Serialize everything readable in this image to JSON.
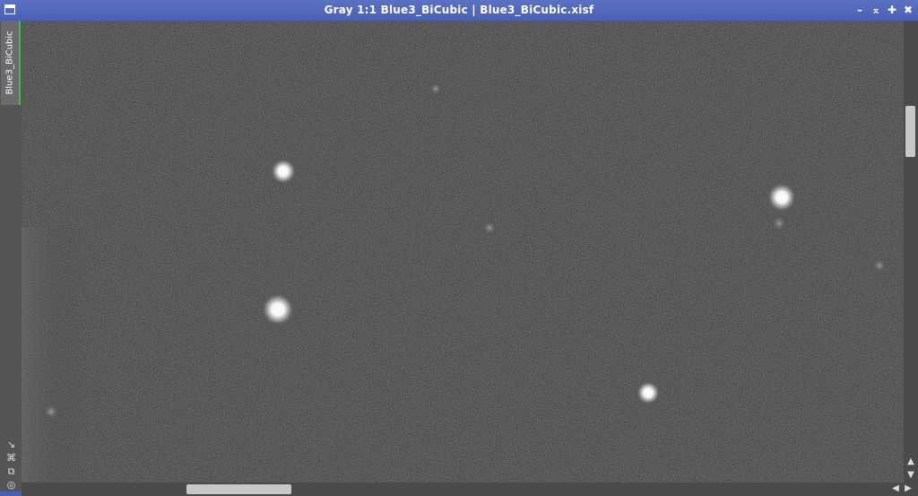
{
  "window": {
    "title": "Gray 1:1 Blue3_BiCubic | Blue3_BiCubic.xisf",
    "controls": {
      "minimize": "–",
      "shade": "⌅",
      "maximize": "✚",
      "close": "✖"
    }
  },
  "view_tab": {
    "label": "Blue3_BiCubic"
  },
  "side_tools": [
    {
      "icon": "resize-arrow-icon",
      "glyph": "↘"
    },
    {
      "icon": "fit-frame-icon",
      "glyph": "⌘"
    },
    {
      "icon": "clone-icon",
      "glyph": "⧉"
    },
    {
      "icon": "target-icon",
      "glyph": "◎"
    }
  ],
  "scrollbars": {
    "vertical": {
      "position": 0.19
    },
    "horizontal": {
      "position": 0.19,
      "arrows": [
        "◀",
        "▶"
      ],
      "v_arrows": [
        "▲",
        "▼"
      ]
    }
  },
  "colors": {
    "titlebar": "#4a60b3",
    "canvas_background": "#333333",
    "tab_accent": "#3bbf5a"
  }
}
